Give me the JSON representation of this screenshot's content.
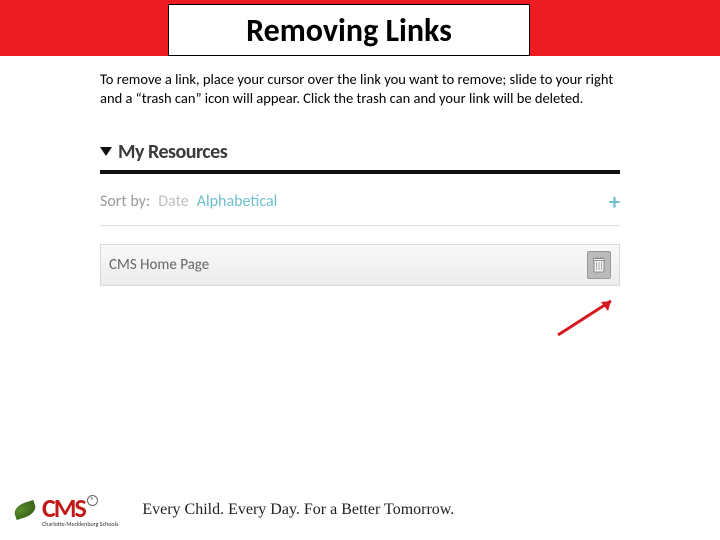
{
  "header": {
    "title": "Removing Links"
  },
  "instructions": "To remove a link, place your cursor over the link you want to remove; slide to your right and a “trash can” icon will appear.  Click the trash can and your link will be deleted.",
  "widget": {
    "section_title": "My Resources",
    "sort": {
      "label": "Sort by:",
      "date": "Date",
      "alpha": "Alphabetical"
    },
    "link_item": "CMS Home Page"
  },
  "footer": {
    "logo_text": "CMS",
    "logo_sub": "Charlotte-Mecklenburg Schools",
    "reg": "®",
    "slogan": "Every Child. Every Day. For a Better Tomorrow."
  }
}
